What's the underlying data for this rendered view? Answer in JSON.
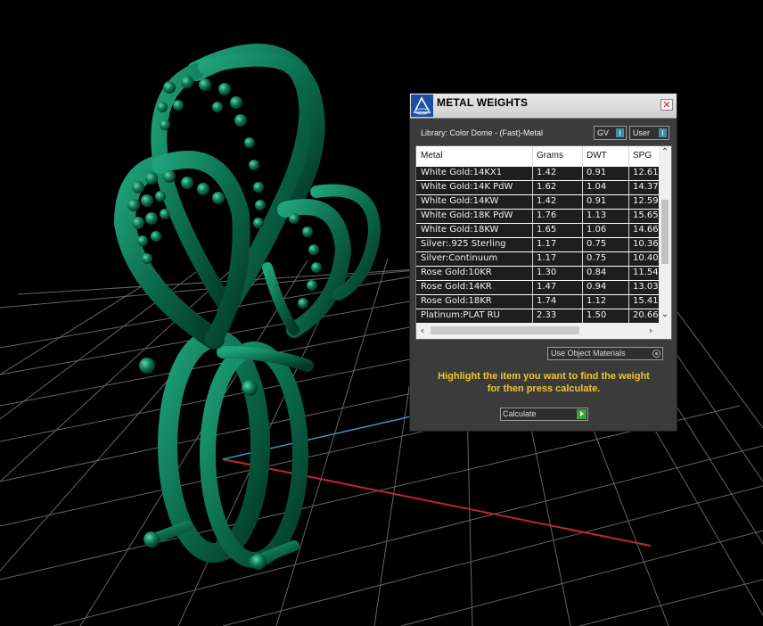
{
  "dialog": {
    "title": "METAL WEIGHTS",
    "close_glyph": "✕",
    "library_label": "Library: Color Dome - (Fast)-Metal",
    "toggle_gv": "GV",
    "toggle_user": "User",
    "columns": [
      "Metal",
      "Grams",
      "DWT",
      "SPG"
    ],
    "rows": [
      {
        "metal": "White Gold:14KX1",
        "grams": "1.42",
        "dwt": "0.91",
        "spg": "12.61"
      },
      {
        "metal": "White Gold:14K PdW",
        "grams": "1.62",
        "dwt": "1.04",
        "spg": "14.37"
      },
      {
        "metal": "White Gold:14KW",
        "grams": "1.42",
        "dwt": "0.91",
        "spg": "12.59"
      },
      {
        "metal": "White Gold:18K PdW",
        "grams": "1.76",
        "dwt": "1.13",
        "spg": "15.65"
      },
      {
        "metal": "White Gold:18KW",
        "grams": "1.65",
        "dwt": "1.06",
        "spg": "14.66"
      },
      {
        "metal": "Silver:.925 Sterling",
        "grams": "1.17",
        "dwt": "0.75",
        "spg": "10.36"
      },
      {
        "metal": "Silver:Continuum",
        "grams": "1.17",
        "dwt": "0.75",
        "spg": "10.40"
      },
      {
        "metal": "Rose Gold:10KR",
        "grams": "1.30",
        "dwt": "0.84",
        "spg": "11.54"
      },
      {
        "metal": "Rose Gold:14KR",
        "grams": "1.47",
        "dwt": "0.94",
        "spg": "13.03"
      },
      {
        "metal": "Rose Gold:18KR",
        "grams": "1.74",
        "dwt": "1.12",
        "spg": "15.41"
      },
      {
        "metal": "Platinum:PLAT RU",
        "grams": "2.33",
        "dwt": "1.50",
        "spg": "20.66"
      }
    ],
    "materials_dropdown": "Use Object Materials",
    "hint_line1": "Highlight the item you want to find the weight",
    "hint_line2": "for then press calculate.",
    "calculate_label": "Calculate"
  },
  "colors": {
    "viewport_bg": "#000000",
    "model_green": "#0b6b4c",
    "hint_text": "#f0c62e",
    "axis_x": "#c0262f",
    "axis_y": "#3a9ab8",
    "calc_go": "#3aa336"
  },
  "icons": {
    "app": "cad-app-icon",
    "close": "close-icon",
    "toggle": "toggle-icon",
    "dropdown": "dropdown-arrow-icon",
    "run": "play-icon"
  }
}
